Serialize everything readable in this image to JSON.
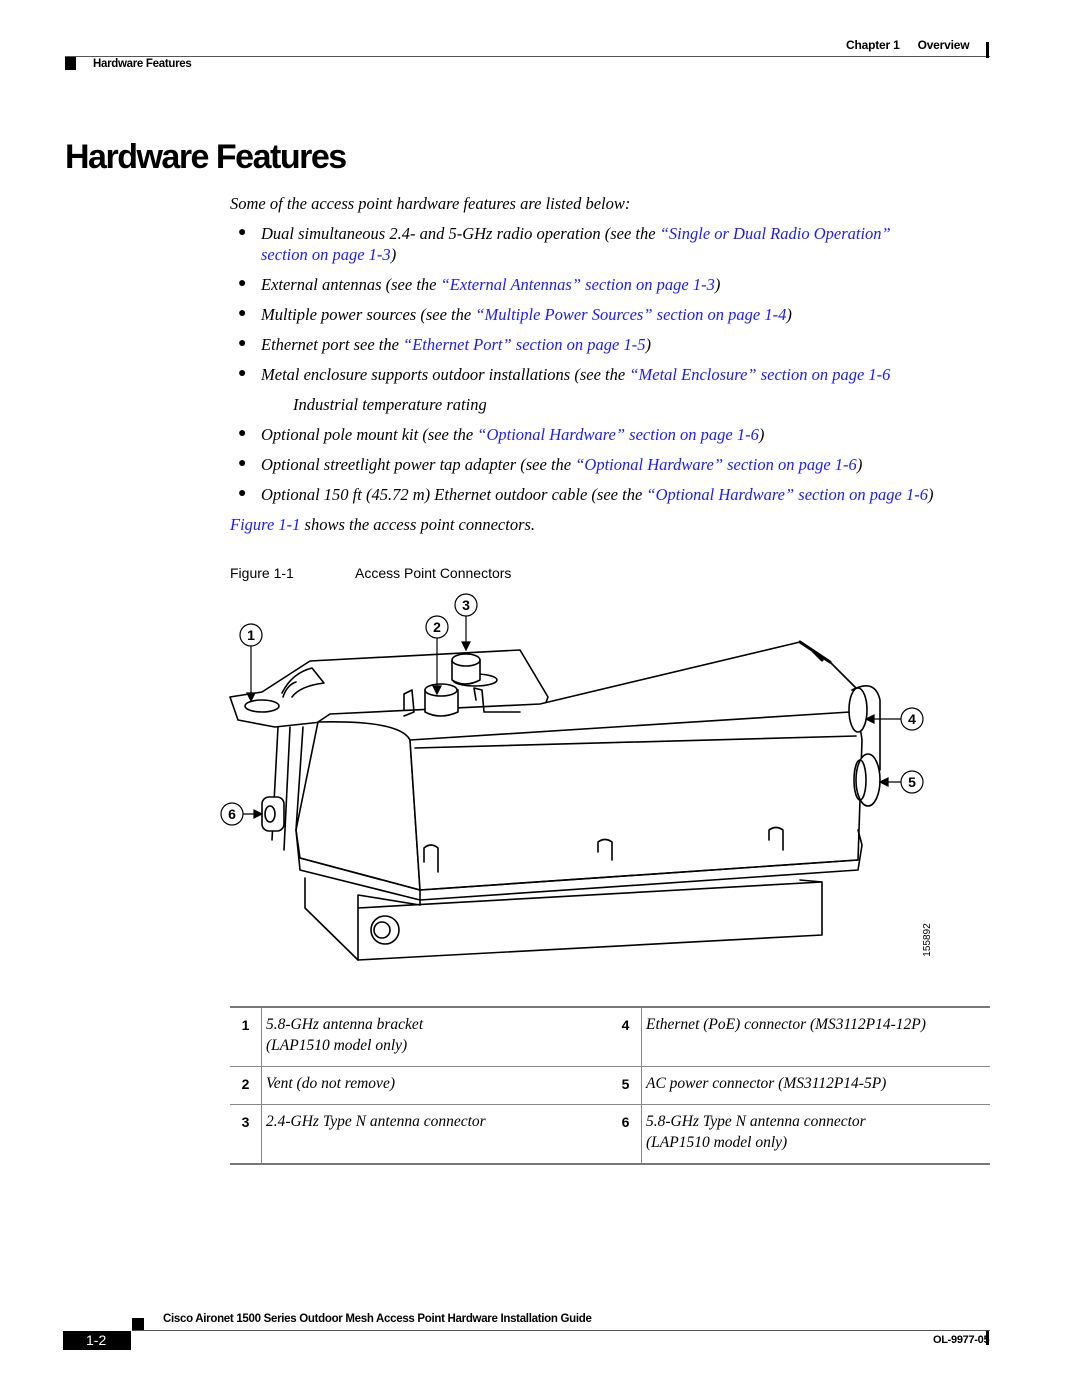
{
  "header": {
    "chapter": "Chapter 1",
    "chapter_title": "Overview",
    "section": "Hardware Features"
  },
  "page_title": "Hardware Features",
  "intro": "Some of the access point hardware features are listed below:",
  "features": [
    {
      "pre": "Dual simultaneous 2.4- and 5-GHz radio operation (see the ",
      "link": "“Single or Dual Radio Operation”",
      "line2_link": "section on page 1-3",
      "post": ")"
    },
    {
      "pre": "External antennas (see the ",
      "link": "“External Antennas” section on page 1-3",
      "post": ")"
    },
    {
      "pre": "Multiple power sources (see the ",
      "link": "“Multiple Power Sources” section on page 1-4",
      "post": ")"
    },
    {
      "pre": "Ethernet port see the ",
      "link": "“Ethernet Port” section on page 1-5",
      "post": ")"
    },
    {
      "pre": "Metal enclosure supports outdoor installations (see the ",
      "link": "“Metal Enclosure” section on page 1-6",
      "post": ""
    },
    {
      "pre": "Optional pole mount kit (see the ",
      "link": "“Optional Hardware” section on page 1-6",
      "post": ")"
    },
    {
      "pre": "Optional streetlight power tap adapter (see the ",
      "link": "“Optional Hardware” section on page 1-6",
      "post": ")"
    },
    {
      "pre": "Optional 150 ft (45.72 m) Ethernet outdoor cable (see the ",
      "link": "“Optional Hardware” section on page 1-6",
      "post": ")"
    }
  ],
  "industrial_note": "Industrial temperature rating",
  "figure_ref": {
    "link": "Figure 1-1",
    "text": " shows the access point connectors."
  },
  "figure": {
    "number": "Figure 1-1",
    "title": "Access Point Connectors",
    "callouts": [
      "1",
      "2",
      "3",
      "4",
      "5",
      "6"
    ],
    "art_id": "155892"
  },
  "legend": [
    {
      "num": "1",
      "desc": "5.8-GHz antenna bracket",
      "desc2": "(LAP1510 model only)",
      "num_b": "4",
      "desc_b": "Ethernet (PoE) connector (MS3112P14-12P)",
      "desc_b2": ""
    },
    {
      "num": "2",
      "desc": "Vent (do not remove)",
      "desc2": "",
      "num_b": "5",
      "desc_b": "AC power connector (MS3112P14-5P)",
      "desc_b2": ""
    },
    {
      "num": "3",
      "desc": "2.4-GHz Type N antenna connector",
      "desc2": "",
      "num_b": "6",
      "desc_b": "5.8-GHz Type N antenna connector",
      "desc_b2": "(LAP1510 model only)"
    }
  ],
  "footer": {
    "guide_title": "Cisco Aironet 1500 Series Outdoor Mesh Access Point Hardware Installation Guide",
    "page": "1-2",
    "doc_number": "OL-9977-05"
  }
}
